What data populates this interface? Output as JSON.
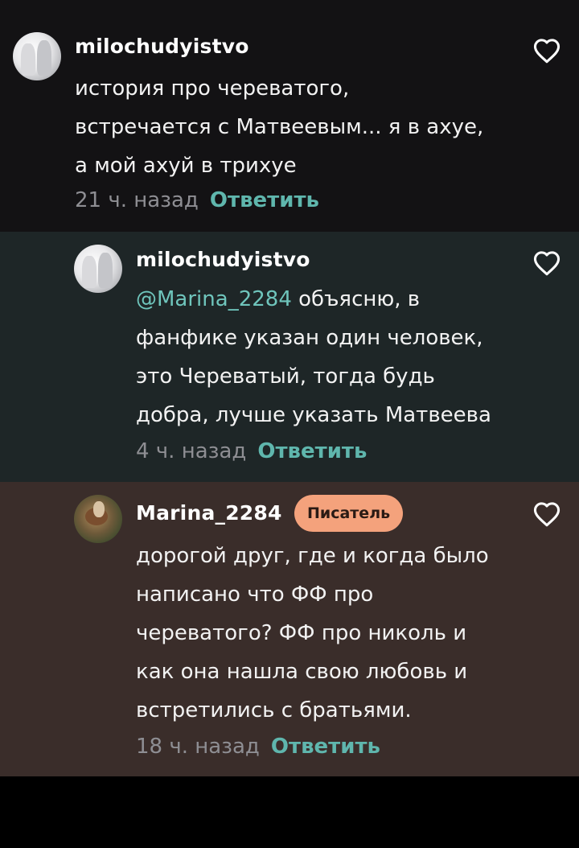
{
  "comments": [
    {
      "username": "milochudyistvo",
      "mention": "",
      "text": "история про череватого,\nвстречается с Матвеевым... я в ахуе,\nа мой ахуй в трихуе",
      "time": "21 ч. назад",
      "reply_label": "Ответить",
      "badge": "",
      "avatar_icon": "user-avatar-icon"
    },
    {
      "username": "milochudyistvo",
      "mention": "@Marina_2284",
      "text": " объясню, в\nфанфике указан один человек,\nэто Череватый, тогда будь\nдобра, лучше указать Матвеева",
      "time": "4 ч. назад",
      "reply_label": "Ответить",
      "badge": "",
      "avatar_icon": "user-avatar-icon"
    },
    {
      "username": "Marina_2284",
      "mention": "",
      "text": "дорогой друг, где и когда было\nнаписано что ФФ про\nчереватого? ФФ про николь и\nкак она нашла свою любовь и\nвстретились с братьями.",
      "time": "18 ч. назад",
      "reply_label": "Ответить",
      "badge": "Писатель",
      "avatar_icon": "user-avatar-icon"
    }
  ],
  "colors": {
    "accent": "#5fb6ad",
    "badge_bg": "#f4a27c",
    "comment1_bg": "#131214",
    "comment2_bg": "#1e2627",
    "comment3_bg": "#3a2d2a"
  },
  "icons": {
    "like": "heart-outline-icon"
  }
}
